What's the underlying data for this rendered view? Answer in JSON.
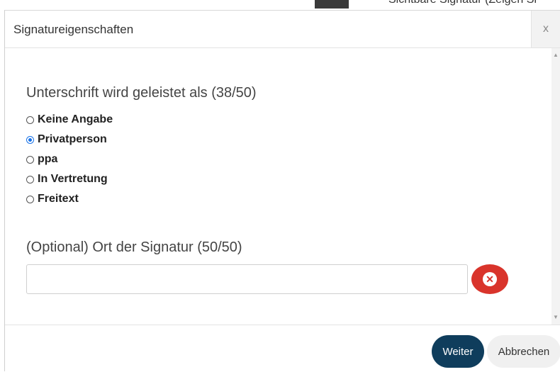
{
  "background": {
    "partial_text": "Sichtbare Signatur (Zeigen Si"
  },
  "dialog": {
    "title": "Signatureigenschaften",
    "close_label": "x",
    "signed_as_label": "Unterschrift wird geleistet als (38/50)",
    "options": [
      {
        "label": "Keine Angabe",
        "checked": false
      },
      {
        "label": "Privatperson",
        "checked": true
      },
      {
        "label": "ppa",
        "checked": false
      },
      {
        "label": "In Vertretung",
        "checked": false
      },
      {
        "label": "Freitext",
        "checked": false
      }
    ],
    "location_label": "(Optional) Ort der Signatur (50/50)",
    "location_value": "",
    "clear_icon": "times-circle-icon",
    "next_label": "Weiter",
    "cancel_label": "Abbrechen"
  },
  "colors": {
    "primary_button": "#0f3d5c",
    "clear_button": "#d9342b",
    "radio_checked": "#1a73e8"
  }
}
